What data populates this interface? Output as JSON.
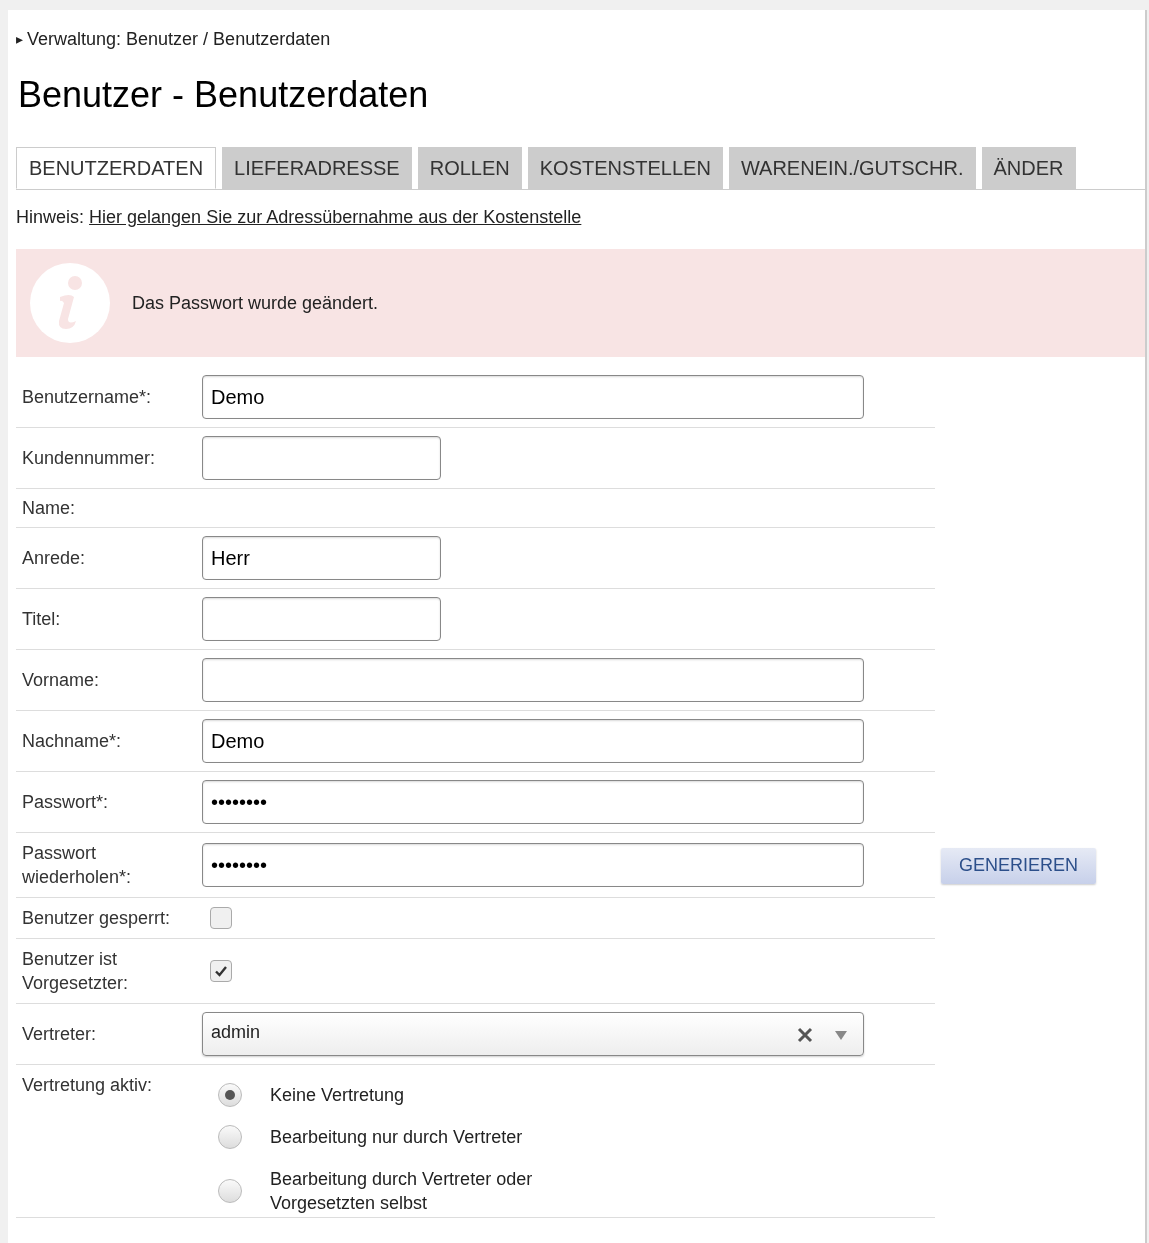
{
  "breadcrumb": {
    "marker": "▸",
    "text": "Verwaltung: Benutzer / Benutzerdaten"
  },
  "title": "Benutzer - Benutzerdaten",
  "tabs": [
    {
      "label": "BENUTZERDATEN",
      "selected": true
    },
    {
      "label": "LIEFERADRESSE",
      "selected": false
    },
    {
      "label": "ROLLEN",
      "selected": false
    },
    {
      "label": "KOSTENSTELLEN",
      "selected": false
    },
    {
      "label": "WARENEIN./GUTSCHR.",
      "selected": false
    },
    {
      "label": "ÄNDER",
      "selected": false
    }
  ],
  "hint": {
    "label": "Hinweis:",
    "link": "Hier gelangen Sie zur Adressübernahme aus der Kostenstelle"
  },
  "alert": {
    "message": "Das Passwort wurde geändert."
  },
  "form": [
    {
      "kind": "longfield",
      "label": "Benutzername*:",
      "value": "Demo"
    },
    {
      "kind": "shortfield",
      "label": "Kundennummer:"
    },
    {
      "kind": "heading",
      "label": "Name:"
    },
    {
      "kind": "shortfield",
      "label": "Anrede:",
      "value": "Herr"
    },
    {
      "kind": "shortfield",
      "label": "Titel:"
    },
    {
      "kind": "longfield",
      "label": "Vorname:"
    },
    {
      "kind": "longfield",
      "label": "Nachname*:",
      "value": "Demo"
    },
    {
      "kind": "longfield",
      "label": "Passwort*:",
      "value": "••••••••"
    },
    {
      "kind": "longfield",
      "label": "Passwort wiederholen*:",
      "value": "••••••••",
      "button": "GENERIEREN"
    },
    {
      "kind": "checkbox",
      "label": "Benutzer gesperrt:",
      "checked": false
    },
    {
      "kind": "checkbox",
      "label": "Benutzer ist Vorgesetzter:",
      "checked": true
    },
    {
      "kind": "select",
      "label": "Vertreter:",
      "value": "admin"
    },
    {
      "kind": "radio",
      "label": "Vertretung aktiv:",
      "options": [
        {
          "label": "Keine Vertretung",
          "selected": true
        },
        {
          "label": "Bearbeitung nur durch Vertreter",
          "selected": false
        },
        {
          "label": "Bearbeitung durch Vertreter oder Vorgesetzten selbst",
          "selected": false
        }
      ]
    }
  ]
}
